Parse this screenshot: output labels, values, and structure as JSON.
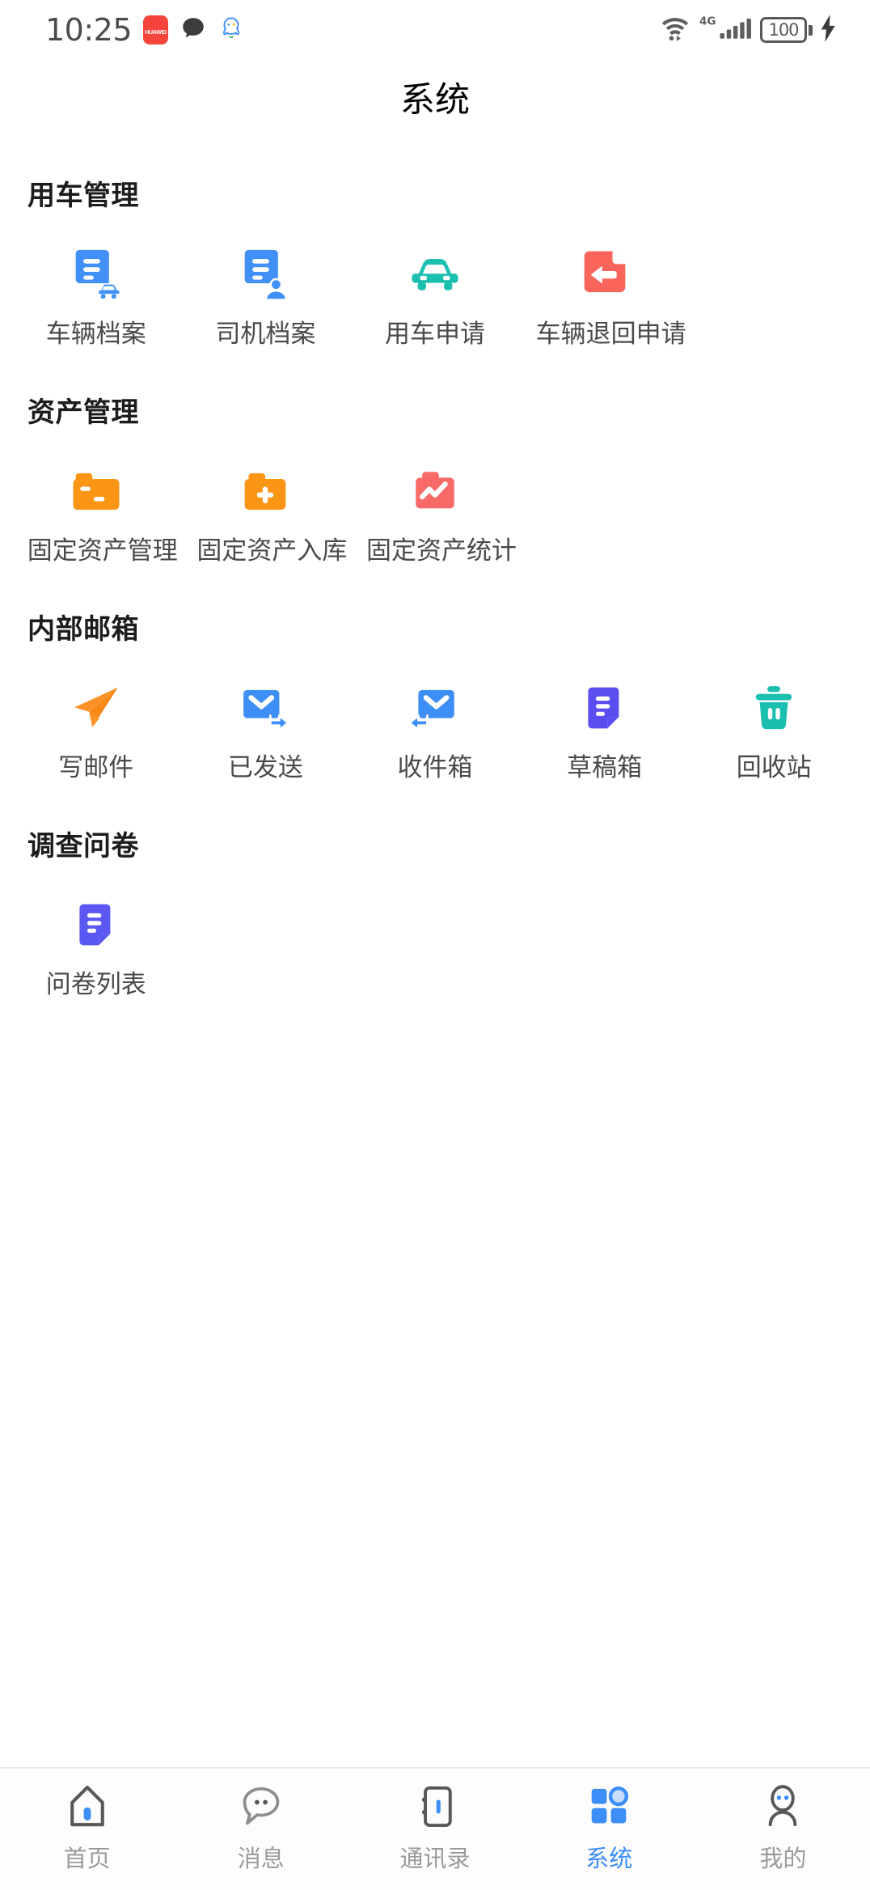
{
  "status_bar": {
    "time": "10:25",
    "app_badge_label": "HUAWEI",
    "icons": [
      "huawei-badge",
      "chat-bubble-icon",
      "qq-icon",
      "wifi-icon",
      "signal-4g-icon",
      "battery-icon",
      "charging-bolt-icon"
    ],
    "network_type": "4G",
    "battery_level": "100"
  },
  "header": {
    "title": "系统"
  },
  "sections": [
    {
      "title": "用车管理",
      "items": [
        {
          "label": "车辆档案",
          "icon": "vehicle-file-icon",
          "color": "#4190f7"
        },
        {
          "label": "司机档案",
          "icon": "driver-file-icon",
          "color": "#4190f7"
        },
        {
          "label": "用车申请",
          "icon": "car-icon",
          "color": "#1bbfaf"
        },
        {
          "label": "车辆退回申请",
          "icon": "vehicle-return-icon",
          "color": "#f9655b"
        }
      ]
    },
    {
      "title": "资产管理",
      "items": [
        {
          "label": "固定资产管理",
          "icon": "folder-asset-icon",
          "color": "#fa9515"
        },
        {
          "label": "固定资产入库",
          "icon": "folder-plus-icon",
          "color": "#fa9515"
        },
        {
          "label": "固定资产统计",
          "icon": "folder-chart-icon",
          "color": "#f76a68"
        }
      ]
    },
    {
      "title": "内部邮箱",
      "items": [
        {
          "label": "写邮件",
          "icon": "paper-plane-icon",
          "color": "#fa9228"
        },
        {
          "label": "已发送",
          "icon": "mail-sent-icon",
          "color": "#3d8ef7"
        },
        {
          "label": "收件箱",
          "icon": "mail-inbox-icon",
          "color": "#3d8ef7"
        },
        {
          "label": "草稿箱",
          "icon": "draft-document-icon",
          "color": "#5a4ef0"
        },
        {
          "label": "回收站",
          "icon": "trash-icon",
          "color": "#1bbfaf"
        }
      ]
    },
    {
      "title": "调查问卷",
      "items": [
        {
          "label": "问卷列表",
          "icon": "survey-document-icon",
          "color": "#5a57f2"
        }
      ]
    }
  ],
  "tabbar": {
    "active_index": 3,
    "items": [
      {
        "label": "首页",
        "icon": "home-icon"
      },
      {
        "label": "消息",
        "icon": "message-icon"
      },
      {
        "label": "通讯录",
        "icon": "contacts-icon"
      },
      {
        "label": "系统",
        "icon": "system-grid-icon"
      },
      {
        "label": "我的",
        "icon": "profile-icon"
      }
    ]
  },
  "colors": {
    "accent": "#3d8ef7",
    "inactive_tab": "#9a9a9a",
    "label_text": "#4a4a4a",
    "section_title": "#1c1c1c"
  }
}
